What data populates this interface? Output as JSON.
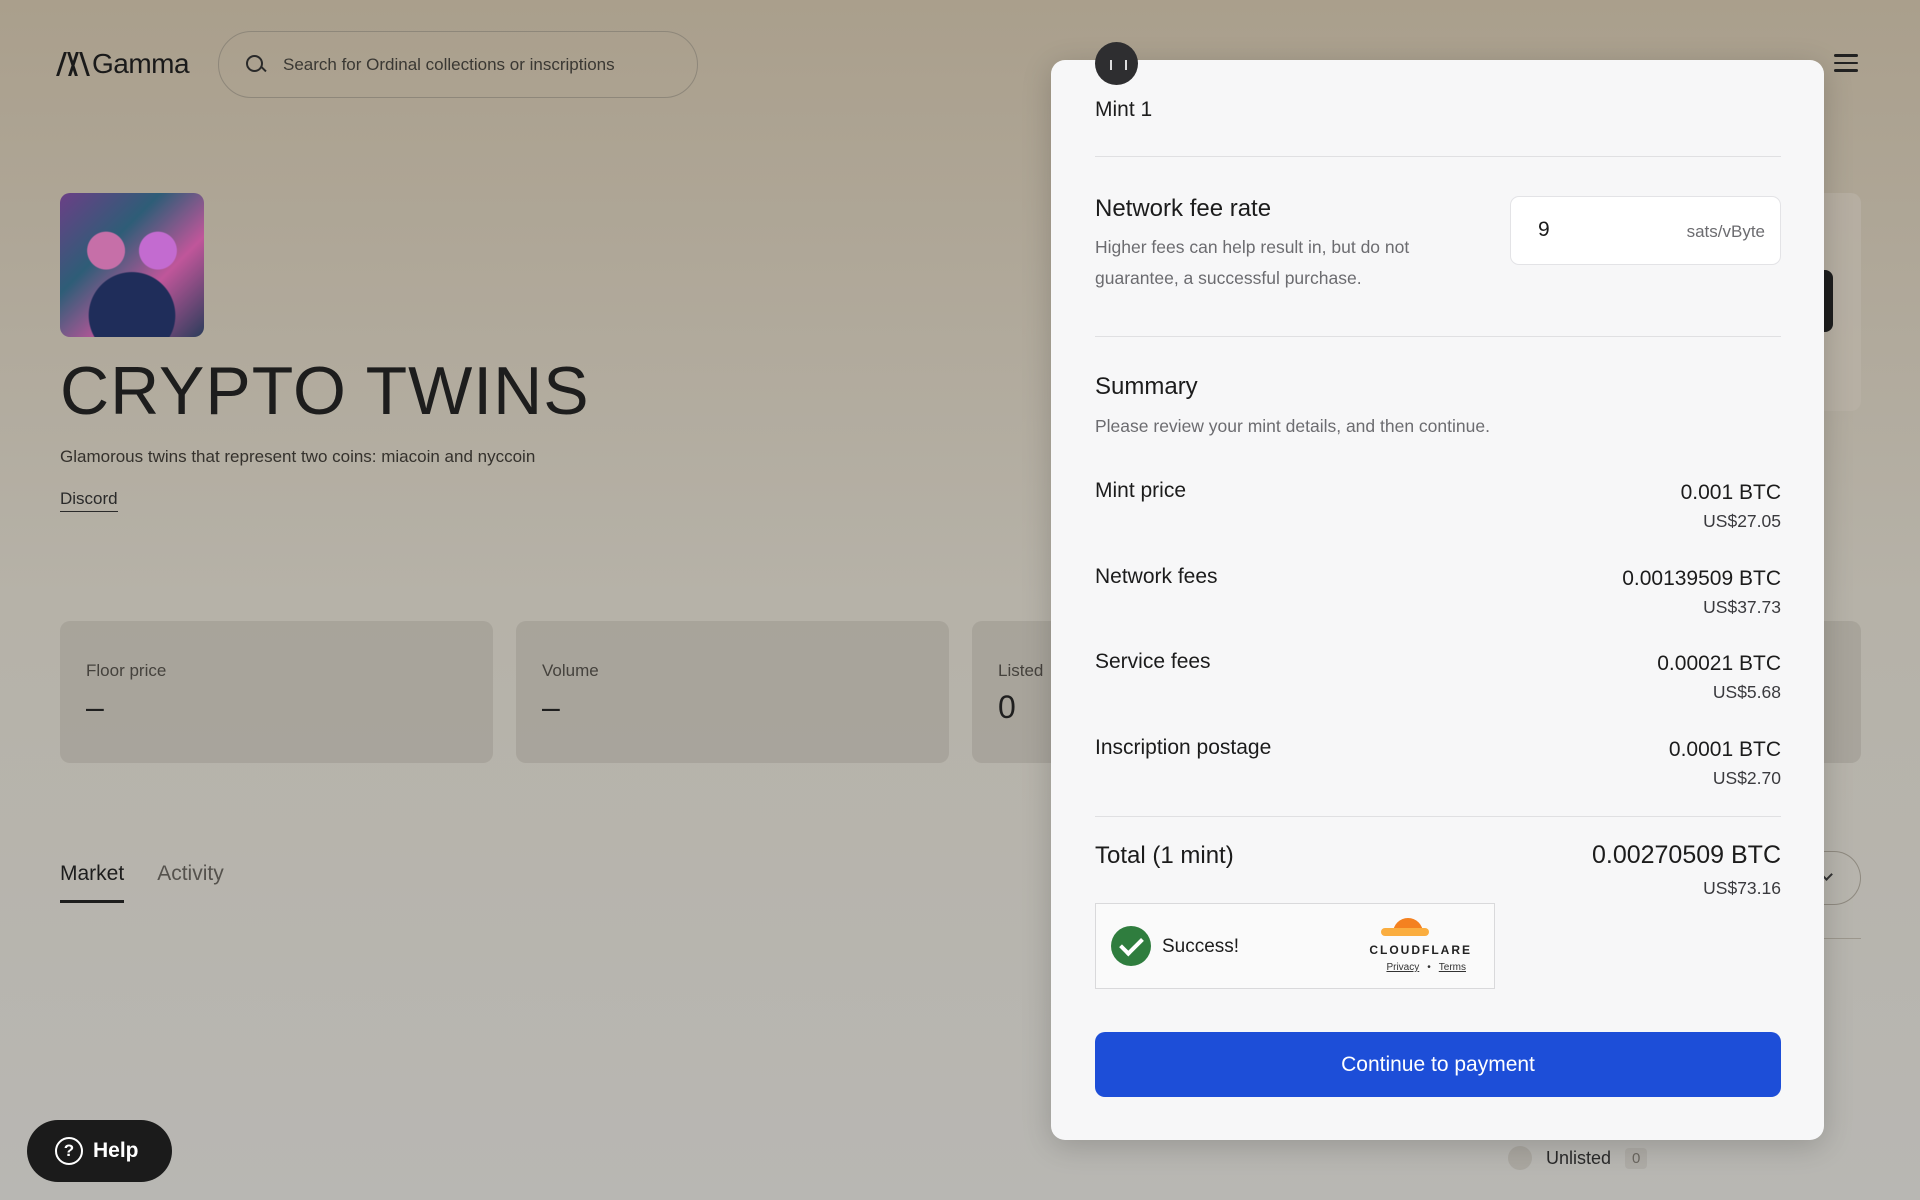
{
  "header": {
    "logo_text": "Gamma",
    "search_placeholder": "Search for Ordinal collections or inscriptions"
  },
  "collection": {
    "title": "CRYPTO TWINS",
    "description": "Glamorous twins that represent two coins: miacoin and nyccoin",
    "discord_label": "Discord"
  },
  "stats": [
    {
      "label": "Floor price",
      "value": "–"
    },
    {
      "label": "Volume",
      "value": "–"
    },
    {
      "label": "Listed",
      "value": "0"
    }
  ],
  "tabs": [
    {
      "label": "Market",
      "active": true
    },
    {
      "label": "Activity",
      "active": false
    }
  ],
  "filter": {
    "unlisted_label": "Unlisted",
    "unlisted_count": "0"
  },
  "help": {
    "label": "Help",
    "icon": "question-icon"
  },
  "modal": {
    "mint_label": "Mint 1",
    "fee": {
      "title": "Network fee rate",
      "description": "Higher fees can help result in, but do not guarantee, a successful purchase.",
      "value": "9",
      "unit": "sats/vByte"
    },
    "summary": {
      "title": "Summary",
      "description": "Please review your mint details, and then continue.",
      "items": [
        {
          "label": "Mint price",
          "btc": "0.001 BTC",
          "usd": "US$27.05"
        },
        {
          "label": "Network fees",
          "btc": "0.00139509 BTC",
          "usd": "US$37.73"
        },
        {
          "label": "Service fees",
          "btc": "0.00021 BTC",
          "usd": "US$5.68"
        },
        {
          "label": "Inscription postage",
          "btc": "0.0001 BTC",
          "usd": "US$2.70"
        }
      ],
      "total": {
        "label": "Total (1 mint)",
        "btc": "0.00270509 BTC",
        "usd": "US$73.16"
      }
    },
    "captcha": {
      "status": "Success!",
      "brand": "CLOUDFLARE",
      "privacy": "Privacy",
      "separator": "•",
      "terms": "Terms"
    },
    "continue_label": "Continue to payment"
  },
  "colors": {
    "primary_button": "#1d4ed8",
    "success": "#2f7d3e",
    "cloudflare_orange": "#f48120"
  }
}
